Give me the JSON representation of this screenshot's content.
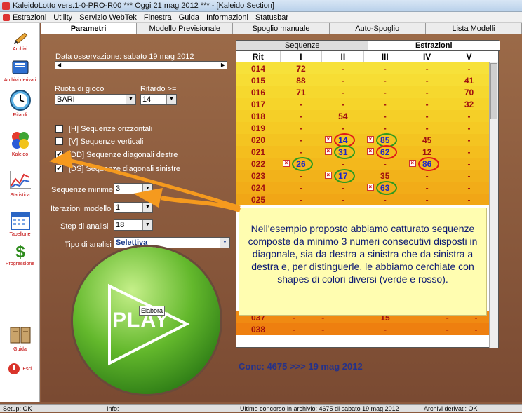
{
  "window": {
    "title": "KaleidoLotto vers.1-0-PRO-R00  ***  Oggi 21 mag 2012  ***  - [Kaleido Section]"
  },
  "menu": [
    "Estrazioni",
    "Utility",
    "Servizio WebTek",
    "Finestra",
    "Guida",
    "Informazioni",
    "Statusbar"
  ],
  "sidebar": [
    {
      "label": "Archivi",
      "icon": "pencil-icon"
    },
    {
      "label": "Archivi derivati",
      "icon": "book-icon"
    },
    {
      "label": "Ritardi",
      "icon": "clock-icon"
    },
    {
      "label": "Kaleido",
      "icon": "balls-icon"
    },
    {
      "label": "Statistica",
      "icon": "chart-icon"
    },
    {
      "label": "Tabellone",
      "icon": "calendar-icon"
    },
    {
      "label": "Progressione",
      "icon": "dollar-icon"
    },
    {
      "label": "Guida",
      "icon": "guide-book-icon"
    },
    {
      "label": "Esci",
      "icon": "exit-icon"
    }
  ],
  "tabs": [
    "Parametri",
    "Modello Previsionale",
    "Spoglio manuale",
    "Auto-Spoglio",
    "Lista Modelli"
  ],
  "params": {
    "data_oss": "Data osservazione: sabato 19 mag 2012",
    "ruota_label": "Ruota di gioco",
    "ruota_value": "BARI",
    "ritardo_label": "Ritardo >=",
    "ritardo_value": "14",
    "cb": [
      {
        "label": "[H] Sequenze orizzontali",
        "checked": false
      },
      {
        "label": "[V] Sequenze verticali",
        "checked": false
      },
      {
        "label": "[DD] Sequenze diagonali destre",
        "checked": true
      },
      {
        "label": "[DS] Sequenze diagonali sinistre",
        "checked": true
      }
    ],
    "seq_min_label": "Sequenze minime",
    "seq_min_value": "3",
    "iter_label": "Iterazioni modello",
    "iter_value": "1",
    "step_label": "Step di analisi",
    "step_value": "18",
    "tipo_label": "Tipo di analisi",
    "tipo_value": "Selettiva"
  },
  "grid": {
    "tab_left": "Sequenze",
    "tab_right": "Estrazioni",
    "headers": [
      "Rit",
      "I",
      "II",
      "III",
      "IV",
      "V"
    ],
    "rows": [
      {
        "rit": "014",
        "cells": [
          "72",
          "-",
          "-",
          "-",
          "-"
        ]
      },
      {
        "rit": "015",
        "cells": [
          "88",
          "-",
          "-",
          "-",
          "41"
        ]
      },
      {
        "rit": "016",
        "cells": [
          "71",
          "-",
          "-",
          "-",
          "70"
        ]
      },
      {
        "rit": "017",
        "cells": [
          "-",
          "-",
          "-",
          "-",
          "32"
        ]
      },
      {
        "rit": "018",
        "cells": [
          "-",
          "54",
          "-",
          "-",
          "-"
        ]
      },
      {
        "rit": "019",
        "cells": [
          "-",
          "-",
          "-",
          "-",
          "-"
        ]
      },
      {
        "rit": "020",
        "cells": [
          "-",
          "14",
          "85",
          "45",
          "-"
        ]
      },
      {
        "rit": "021",
        "cells": [
          "-",
          "31",
          "62",
          "12",
          "-"
        ]
      },
      {
        "rit": "022",
        "cells": [
          "26",
          "-",
          "-",
          "86",
          "-"
        ]
      },
      {
        "rit": "023",
        "cells": [
          "-",
          "17",
          "35",
          "-",
          "-"
        ]
      },
      {
        "rit": "024",
        "cells": [
          "-",
          "-",
          "63",
          "-",
          "-"
        ]
      },
      {
        "rit": "025",
        "cells": [
          "-",
          "-",
          "-",
          "-",
          "-"
        ]
      }
    ],
    "bottom_rows": [
      {
        "rit": "037",
        "cells": [
          "-",
          "-",
          "15",
          "-",
          "-"
        ]
      },
      {
        "rit": "038",
        "cells": [
          "-",
          "-",
          "-",
          "-",
          "-"
        ]
      }
    ]
  },
  "note": "Nell'esempio proposto abbiamo catturato sequenze composte da minimo 3 numeri consecutivi disposti in diagonale, sia da destra a sinistra che da sinistra a destra e, per distinguerle, le abbiamo cerchiate con shapes di colori diversi (verde  e rosso).",
  "conc": "Conc: 4675 >>> 19 mag 2012",
  "play": {
    "label": "PLAY",
    "tooltip": "Elabora"
  },
  "status": {
    "setup": "Setup: OK",
    "info": "Info:",
    "ultimo": "Ultimo concorso in archivio: 4675 di sabato 19 mag 2012",
    "derivati": "Archivi derivati: OK"
  },
  "colors": {
    "ring_green": "#2c9a1f",
    "ring_red": "#e01818",
    "arrow": "#f59a1e",
    "note_bg": "#fffdb0"
  }
}
